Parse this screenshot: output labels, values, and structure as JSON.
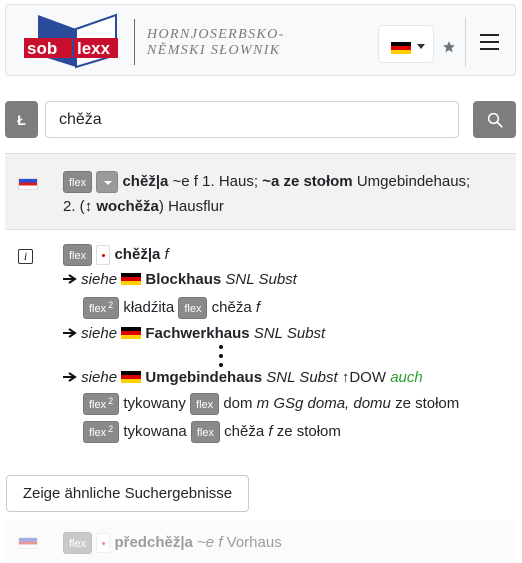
{
  "header": {
    "logo_text_left": "sob",
    "logo_text_right": "lexx",
    "title_line1": "HORNJOSERBSKO-",
    "title_line2": "NĚMSKI SŁOWNIK",
    "language_flag": "de-flag",
    "colors": {
      "logo_blue": "#2a4a9a",
      "logo_red": "#c8102e"
    }
  },
  "search": {
    "l_button": "Ł",
    "query": "chěža"
  },
  "entry1": {
    "flex": "flex",
    "lemma": "chěž|a",
    "grammar": "~e f",
    "sense1": "1. Haus;",
    "phrase": "~a ze stołom",
    "phrase_trans": "Umgebindehaus;",
    "sense2_num": "2. (",
    "sense2_arrow": "↕",
    "sense2_ref": "wochěža",
    "sense2_close": ")",
    "sense2_trans": "Hausflur"
  },
  "entry2": {
    "flex": "flex",
    "lemma": "chěž|a",
    "gender": "f",
    "see1": {
      "siehe": "siehe",
      "word": "Blockhaus",
      "src": "SNL Subst",
      "rows": [
        {
          "flex": "flex",
          "sup": "2",
          "text": "kładźita"
        },
        {
          "flex": "flex",
          "text": "chěža",
          "gram": "f"
        }
      ]
    },
    "see2": {
      "siehe": "siehe",
      "word": "Fachwerkhaus",
      "src": "SNL Subst"
    },
    "see3": {
      "siehe": "siehe",
      "word": "Umgebindehaus",
      "src": "SNL Subst",
      "ref": "↑DOW",
      "auch": "auch",
      "row1": {
        "flex1": "flex",
        "sup": "2",
        "text1": "tykowany",
        "flex2": "flex",
        "text2": "dom",
        "gram": "m GSg doma, domu",
        "tail": "ze stołom"
      },
      "row2": {
        "flex1": "flex",
        "sup": "2",
        "text1": "tykowana",
        "flex2": "flex",
        "text2": "chěža",
        "gram": "f",
        "tail": "ze stołom"
      }
    }
  },
  "similar_button": "Zeige ähnliche Suchergebnisse",
  "entry3": {
    "flex": "flex",
    "lemma": "předchěž|a",
    "grammar": "~e f",
    "trans": "Vorhaus"
  }
}
